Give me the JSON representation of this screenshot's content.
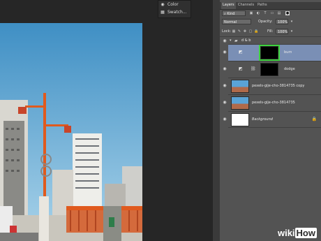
{
  "swatch_menu": {
    "items": [
      {
        "label": "Color",
        "icon": "color-icon"
      },
      {
        "label": "Swatch...",
        "icon": "swatch-grid-icon"
      }
    ]
  },
  "layers_panel": {
    "tabs": [
      "Layers",
      "Channels",
      "Paths"
    ],
    "active_tab": "Layers",
    "filter_label": "Kind",
    "blend_mode": "Normal",
    "opacity_label": "Opacity:",
    "opacity_value": "100%",
    "lock_label": "Lock:",
    "fill_label": "Fill:",
    "fill_value": "100%",
    "group_name": "d & b",
    "layers": [
      {
        "name": "burn",
        "mask": true,
        "selected": true
      },
      {
        "name": "dodge",
        "mask": true,
        "selected": false
      },
      {
        "name": "pexels-gije-cho-3814735 copy",
        "mask": false,
        "selected": false
      },
      {
        "name": "pexels-gije-cho-3814735",
        "mask": false,
        "selected": false
      },
      {
        "name": "Background",
        "mask": false,
        "selected": false,
        "locked": true
      }
    ]
  },
  "watermark": {
    "part1": "wiki",
    "part2": "How"
  },
  "colors": {
    "selection_highlight": "#3fd33f",
    "panel_bg": "#535353",
    "selected_layer_bg": "#7a8fb5",
    "brand_orange": "#e05a1e"
  }
}
